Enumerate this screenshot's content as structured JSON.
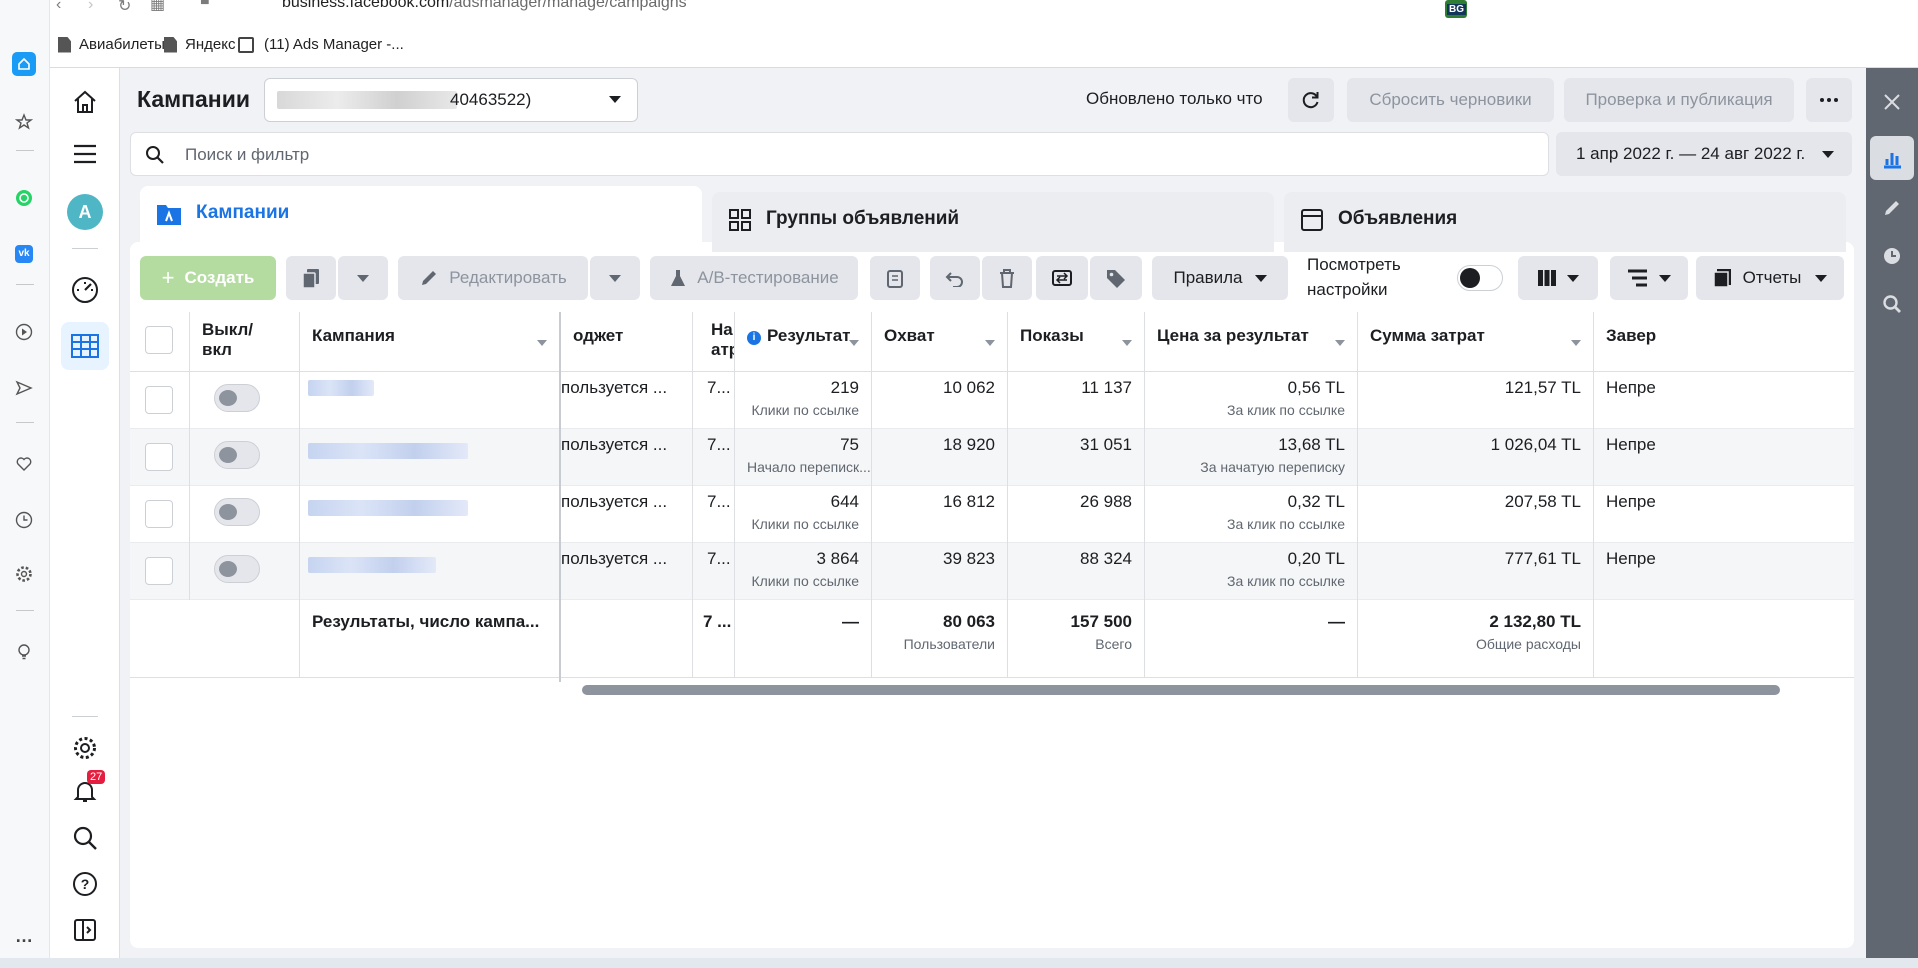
{
  "browser": {
    "url_domain": "business.facebook.com",
    "url_path": "/adsmanager/manage/campaigns",
    "bookmarks": [
      "Авиабилеты",
      "Яндекс",
      "(11) Ads Manager -..."
    ],
    "extension_badge": "BG"
  },
  "nav": {
    "avatar_letter": "A",
    "notification_count": "27"
  },
  "header": {
    "title": "Кампании",
    "account_id_suffix": "40463522)",
    "updated_text": "Обновлено только что",
    "discard_drafts": "Сбросить черновики",
    "review_publish": "Проверка и публикация"
  },
  "search": {
    "placeholder": "Поиск и фильтр"
  },
  "date_range": "1 апр 2022 г. — 24 авг 2022 г.",
  "tabs": {
    "campaigns": "Кампании",
    "adsets": "Группы объявлений",
    "ads": "Объявления"
  },
  "toolbar": {
    "create": "Создать",
    "edit": "Редактировать",
    "ab_test": "A/B-тестирование",
    "rules": "Правила",
    "view_settings": "Посмотреть настройки",
    "reports": "Отчеты"
  },
  "table": {
    "headers": {
      "toggle": "Выкл/ вкл",
      "campaign": "Кампания",
      "budget": "оджет",
      "attribution": "На атр",
      "result": "Результат",
      "reach": "Охват",
      "impressions": "Показы",
      "cost_per_result": "Цена за результат",
      "amount_spent": "Сумма затрат",
      "ends": "Завер"
    },
    "rows": [
      {
        "budget": "пользуется ...",
        "attribution": "7...",
        "result": "219",
        "result_type": "Клики по ссылке",
        "reach": "10 062",
        "impressions": "11 137",
        "cpr": "0,56 TL",
        "cpr_type": "За клик по ссылке",
        "spent": "121,57 TL",
        "ends": "Непре"
      },
      {
        "budget": "пользуется ...",
        "attribution": "7...",
        "result": "75",
        "result_type": "Начало переписк...",
        "reach": "18 920",
        "impressions": "31 051",
        "cpr": "13,68 TL",
        "cpr_type": "За начатую переписку",
        "spent": "1 026,04 TL",
        "ends": "Непре"
      },
      {
        "budget": "пользуется ...",
        "attribution": "7...",
        "result": "644",
        "result_type": "Клики по ссылке",
        "reach": "16 812",
        "impressions": "26 988",
        "cpr": "0,32 TL",
        "cpr_type": "За клик по ссылке",
        "spent": "207,58 TL",
        "ends": "Непре"
      },
      {
        "budget": "пользуется ...",
        "attribution": "7...",
        "result": "3 864",
        "result_type": "Клики по ссылке",
        "reach": "39 823",
        "impressions": "88 324",
        "cpr": "0,20 TL",
        "cpr_type": "За клик по ссылке",
        "spent": "777,61 TL",
        "ends": "Непре"
      }
    ],
    "totals": {
      "label": "Результаты, число кампа...",
      "attribution": "7 ...",
      "result": "—",
      "reach": "80 063",
      "reach_sub": "Пользователи",
      "impressions": "157 500",
      "impressions_sub": "Всего",
      "cpr": "—",
      "spent": "2 132,80 TL",
      "spent_sub": "Общие расходы"
    }
  },
  "colors": {
    "accent": "#1b74e4",
    "create_button": "#b4dca0",
    "right_panel": "#606770",
    "notification": "#e41e3f"
  }
}
